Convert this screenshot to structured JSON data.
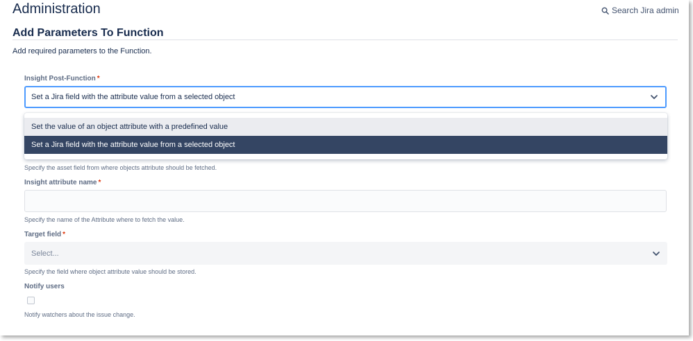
{
  "header": {
    "title": "Administration",
    "search_link": "Search Jira admin"
  },
  "section": {
    "title": "Add Parameters To Function",
    "description": "Add required parameters to the Function."
  },
  "form": {
    "post_function": {
      "label": "Insight Post-Function",
      "required_marker": "*",
      "value": "Set a Jira field with the attribute value from a selected object",
      "options": [
        "Set the value of an object attribute with a predefined value",
        "Set a Jira field with the attribute value from a selected object"
      ]
    },
    "asset_field": {
      "helper": "Specify the asset field from where objects attribute should be fetched."
    },
    "attribute_name": {
      "label": "Insight attribute name",
      "required_marker": "*",
      "value": "",
      "helper": "Specify the name of the Attribute where to fetch the value."
    },
    "target_field": {
      "label": "Target field",
      "required_marker": "*",
      "placeholder": "Select...",
      "helper": "Specify the field where object attribute value should be stored."
    },
    "notify_users": {
      "label": "Notify users",
      "checked": false,
      "helper": "Notify watchers about the issue change."
    }
  },
  "colors": {
    "accent_focus": "#4c9aff",
    "selected_option_bg": "#344563",
    "required": "#de350b"
  }
}
